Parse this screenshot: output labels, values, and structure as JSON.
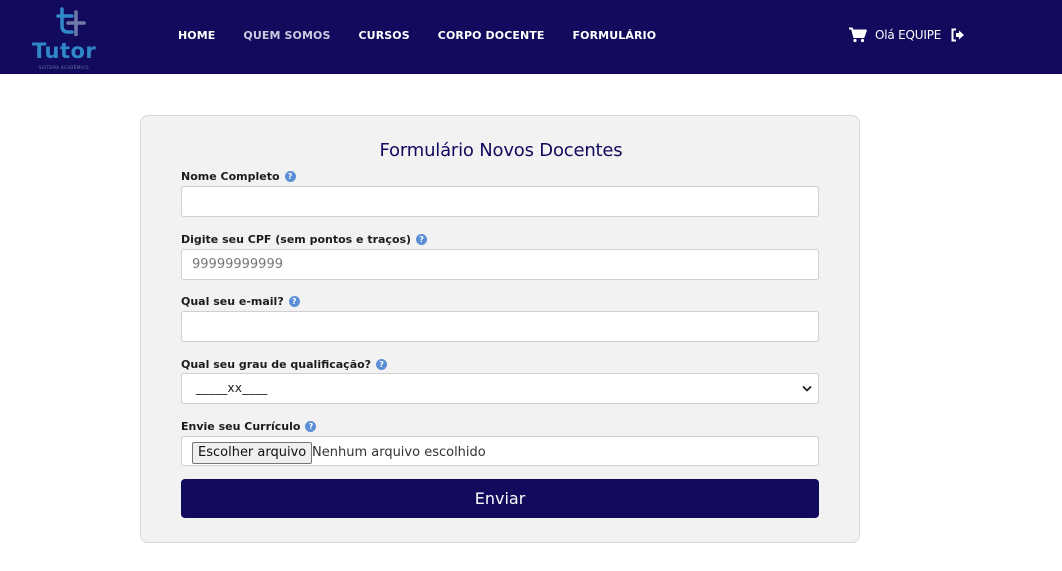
{
  "brand": {
    "name": "Tutor",
    "tagline": "SISTEMA ACADÊMICO"
  },
  "nav": {
    "items": [
      {
        "label": "HOME"
      },
      {
        "label": "QUEM SOMOS"
      },
      {
        "label": "CURSOS"
      },
      {
        "label": "CORPO DOCENTE"
      },
      {
        "label": "FORMULÁRIO"
      }
    ],
    "greeting": "Olá EQUIPE"
  },
  "form": {
    "title": "Formulário Novos Docentes",
    "name_label": "Nome Completo",
    "name_value": "",
    "cpf_label": "Digite seu CPF (sem pontos e traços)",
    "cpf_placeholder": "99999999999",
    "email_label": "Qual seu e-mail?",
    "email_value": "",
    "qualification_label": "Qual seu grau de qualificação?",
    "qualification_selected": "_____xx____",
    "resume_label": "Envie seu Currículo",
    "file_button": "Escolher arquivo",
    "file_status": "Nenhum arquivo escolhido",
    "submit_label": "Enviar",
    "help_symbol": "?"
  },
  "colors": {
    "navbar": "#120a5c",
    "logo": "#2f88c8",
    "help_icon": "#5b8ed6",
    "card_bg": "#f2f2f2",
    "submit": "#120a5c"
  },
  "icons": {
    "cart": "shopping-cart-icon",
    "logout": "sign-out-icon",
    "help": "question-circle-icon",
    "chevron": "chevron-down-icon"
  }
}
